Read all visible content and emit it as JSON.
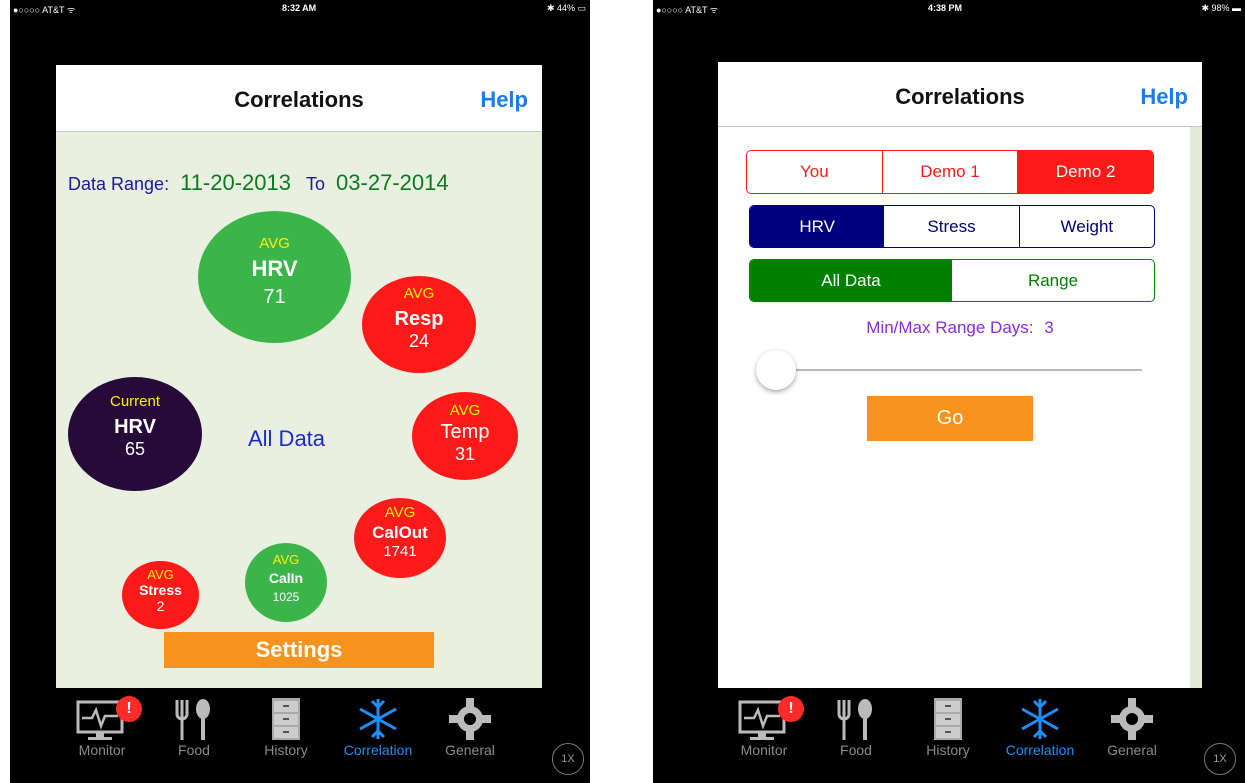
{
  "left": {
    "status": {
      "carrier": "●○○○○ AT&T ᯤ",
      "time": "8:32 AM",
      "battery": "✱ 44% ▭"
    },
    "nav": {
      "title": "Correlations",
      "help": "Help"
    },
    "range": {
      "label": "Data Range:",
      "from": "11-20-2013",
      "to_label": "To",
      "to": "03-27-2014"
    },
    "center_text": "All Data",
    "bubbles": {
      "hrv_avg": {
        "sub": "AVG",
        "name": "HRV",
        "value": "71"
      },
      "resp": {
        "sub": "AVG",
        "name": "Resp",
        "value": "24"
      },
      "current": {
        "sub": "Current",
        "name": "HRV",
        "value": "65"
      },
      "temp": {
        "sub": "AVG",
        "name": "Temp",
        "value": "31"
      },
      "calout": {
        "sub": "AVG",
        "name": "CalOut",
        "value": "1741"
      },
      "calin": {
        "sub": "AVG",
        "name": "CalIn",
        "value": "1025"
      },
      "stress": {
        "sub": "AVG",
        "name": "Stress",
        "value": "2"
      }
    },
    "settings": "Settings"
  },
  "right": {
    "status": {
      "carrier": "●○○○○ AT&T ᯤ",
      "time": "4:38 PM",
      "battery": "✱ 98% ▬"
    },
    "nav": {
      "title": "Correlations",
      "help": "Help"
    },
    "user_seg": [
      "You",
      "Demo 1",
      "Demo 2"
    ],
    "metric_seg": [
      "HRV",
      "Stress",
      "Weight"
    ],
    "data_seg": [
      "All Data",
      "Range"
    ],
    "range_days": {
      "label": "Min/Max Range Days:",
      "value": "3"
    },
    "slider_value": 0.0,
    "go": "Go"
  },
  "tabs": [
    "Monitor",
    "Food",
    "History",
    "Correlation",
    "General"
  ],
  "badge": "!",
  "zoom": "1X",
  "colors": {
    "blue": "#1a7cf0",
    "green": "#008000",
    "red": "#ff1a1a",
    "navy": "#00007f",
    "orange": "#f6921e",
    "purple": "#8a2be2"
  }
}
